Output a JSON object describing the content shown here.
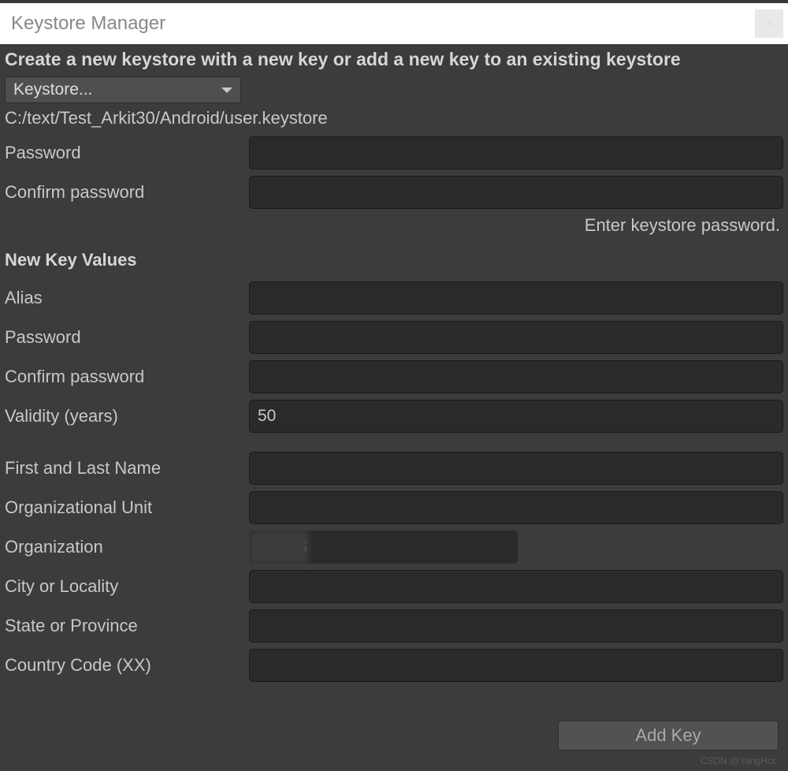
{
  "titlebar": {
    "title": "Keystore Manager",
    "close": "×"
  },
  "heading": "Create a new keystore with a new key or add a new key to an existing keystore",
  "dropdown": {
    "label": "Keystore..."
  },
  "path": "C:/text/Test_Arkit30/Android/user.keystore",
  "keystore": {
    "password_label": "Password",
    "password_value": "",
    "confirm_label": "Confirm password",
    "confirm_value": "",
    "hint": "Enter keystore password."
  },
  "section_title": "New Key Values",
  "newkey": {
    "alias_label": "Alias",
    "alias_value": "",
    "password_label": "Password",
    "password_value": "",
    "confirm_label": "Confirm password",
    "confirm_value": "",
    "validity_label": "Validity (years)",
    "validity_value": "50",
    "firstname_label": "First and Last Name",
    "firstname_value": "",
    "orgunit_label": "Organizational Unit",
    "orgunit_value": "",
    "org_label": "Organization",
    "org_value": "S",
    "city_label": "City or Locality",
    "city_value": "",
    "state_label": "State or Province",
    "state_value": "",
    "country_label": "Country Code (XX)",
    "country_value": ""
  },
  "footer": {
    "add_key_label": "Add Key"
  },
  "watermark": "CSDN @YangHcc"
}
